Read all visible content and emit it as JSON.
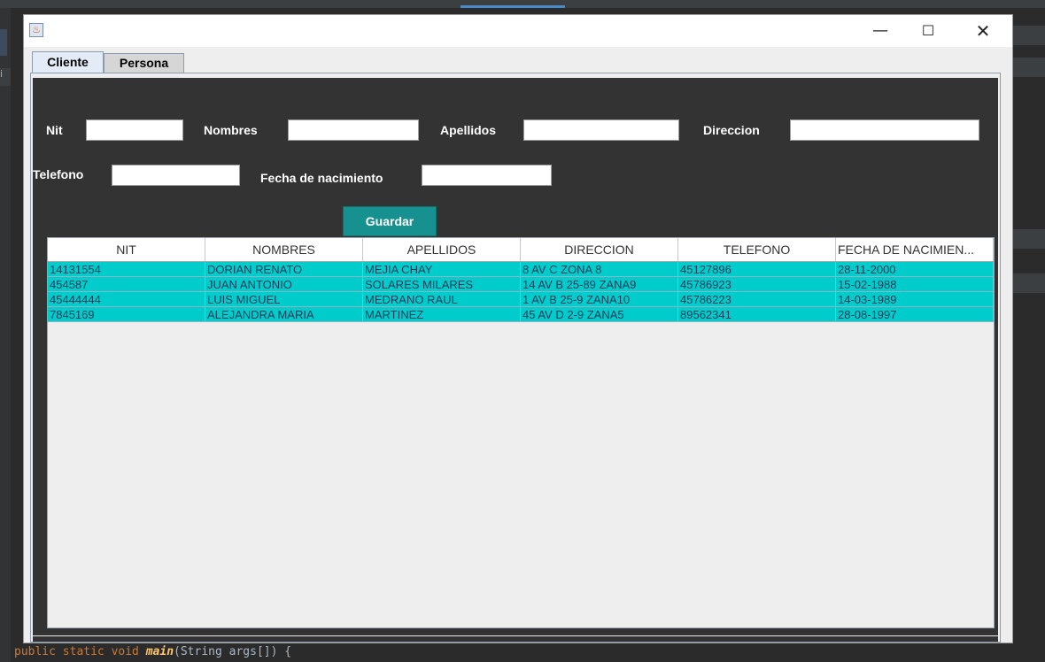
{
  "ide": {
    "code_keywords": "public static void",
    "code_method": "main",
    "code_rest": "(String args[]) {",
    "gutter_char": "i"
  },
  "window": {
    "title": "",
    "minimize": "—",
    "maximize": "☐",
    "close": "✕"
  },
  "tabs": [
    "Cliente",
    "Persona"
  ],
  "form": {
    "nit_label": "Nit",
    "nombres_label": "Nombres",
    "apellidos_label": "Apellidos",
    "direccion_label": "Direccion",
    "telefono_label": "Telefono",
    "fecha_label": "Fecha de nacimiento",
    "nit_value": "",
    "nombres_value": "",
    "apellidos_value": "",
    "direccion_value": "",
    "telefono_value": "",
    "fecha_value": "",
    "save_label": "Guardar"
  },
  "table": {
    "headers": [
      "NIT",
      "NOMBRES",
      "APELLIDOS",
      "DIRECCION",
      "TELEFONO",
      "FECHA DE NACIMIEN..."
    ],
    "rows": [
      [
        "14131554",
        "DORIAN RENATO",
        "MEJIA CHAY",
        "8 AV C ZONA 8",
        "45127896",
        "28-11-2000"
      ],
      [
        "454587",
        "JUAN ANTONIO",
        "SOLARES MILARES",
        "14 AV B 25-89 ZANA9",
        "45786923",
        "15-02-1988"
      ],
      [
        "45444444",
        "LUIS MIGUEL",
        "MEDRANO RAUL",
        "1 AV B 25-9 ZANA10",
        "45786223",
        "14-03-1989"
      ],
      [
        "7845169",
        "ALEJANDRA MARIA",
        "MARTINEZ",
        "45 AV D 2-9 ZANA5",
        "89562341",
        "28-08-1997"
      ]
    ]
  },
  "colors": {
    "row_bg": "#00cccc",
    "button_bg": "#17918f",
    "panel_bg": "#333333"
  }
}
